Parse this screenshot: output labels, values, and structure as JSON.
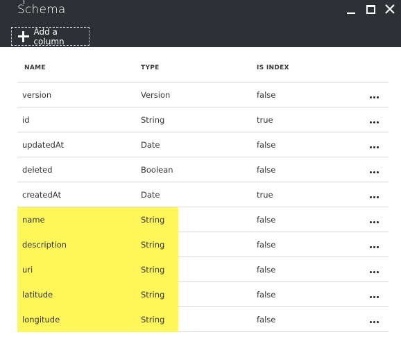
{
  "window": {
    "title": "Schema"
  },
  "toolbar": {
    "add_column_label": "Add a column"
  },
  "table": {
    "columns": [
      "NAME",
      "TYPE",
      "IS INDEX"
    ],
    "rows": [
      {
        "name": "version",
        "type": "Version",
        "is_index": "false",
        "highlighted": false
      },
      {
        "name": "id",
        "type": "String",
        "is_index": "true",
        "highlighted": false
      },
      {
        "name": "updatedAt",
        "type": "Date",
        "is_index": "false",
        "highlighted": false
      },
      {
        "name": "deleted",
        "type": "Boolean",
        "is_index": "false",
        "highlighted": false
      },
      {
        "name": "createdAt",
        "type": "Date",
        "is_index": "true",
        "highlighted": false
      },
      {
        "name": "name",
        "type": "String",
        "is_index": "false",
        "highlighted": true
      },
      {
        "name": "description",
        "type": "String",
        "is_index": "false",
        "highlighted": true
      },
      {
        "name": "uri",
        "type": "String",
        "is_index": "false",
        "highlighted": true
      },
      {
        "name": "latitude",
        "type": "String",
        "is_index": "false",
        "highlighted": true
      },
      {
        "name": "longitude",
        "type": "String",
        "is_index": "false",
        "highlighted": true
      }
    ]
  },
  "colors": {
    "titlebar": "#2d3135",
    "highlight": "#fff65a"
  },
  "icons": {
    "add": "plus-icon",
    "row_menu": "more-icon",
    "minimize": "minimize-icon",
    "maximize": "maximize-icon",
    "close": "close-icon"
  }
}
